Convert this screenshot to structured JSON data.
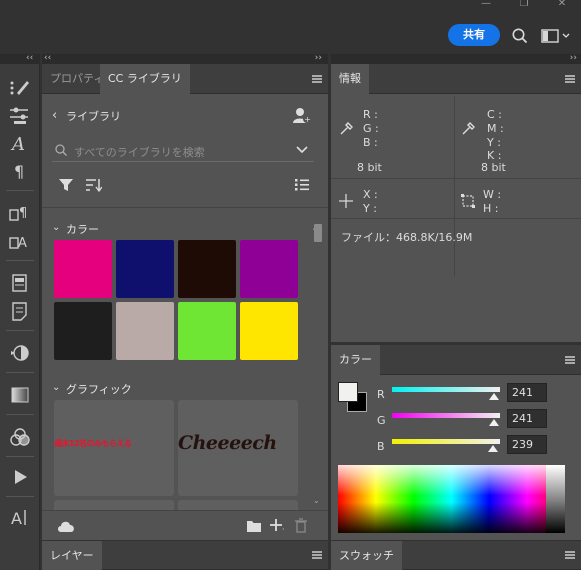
{
  "topbar": {
    "share_label": "共有",
    "search_icon": "search-icon",
    "workspace_icon": "workspace-icon"
  },
  "left_panel": {
    "tabs": [
      {
        "label": "プロパティ"
      },
      {
        "label": "CC ライブラリ"
      }
    ],
    "back_label": "ライブラリ",
    "search_placeholder": "すべてのライブラリを検索",
    "colors_header": "カラー",
    "colors": [
      "#e5007e",
      "#0f0f6e",
      "#1e0b05",
      "#8e0096",
      "#1e1e1e",
      "#b9aaa8",
      "#6ee633",
      "#ffe600"
    ],
    "graphics_header": "グラフィック",
    "graphic1_text": "週末12名のみもらえる",
    "graphic2_text": "Cheeeech"
  },
  "layers_tab": {
    "label": "レイヤー"
  },
  "info_panel": {
    "tab_label": "情報",
    "rgb_labels": [
      "R :",
      "G :",
      "B :"
    ],
    "cmyk_labels": [
      "C :",
      "M :",
      "Y :",
      "K :"
    ],
    "bit_left": "8 bit",
    "bit_right": "8 bit",
    "xy_labels": [
      "X :",
      "Y :"
    ],
    "wh_labels": [
      "W :",
      "H :"
    ],
    "file_label": "ファイル：468.8K/16.9M"
  },
  "color_panel": {
    "tab_label": "カラー",
    "r_label": "R",
    "g_label": "G",
    "b_label": "B",
    "r_value": "241",
    "g_value": "241",
    "b_value": "239",
    "r_fraction": 0.945,
    "g_fraction": 0.945,
    "b_fraction": 0.937,
    "foreground": "#f1f1ef",
    "background": "#000000"
  },
  "swatches_tab": {
    "label": "スウォッチ"
  }
}
